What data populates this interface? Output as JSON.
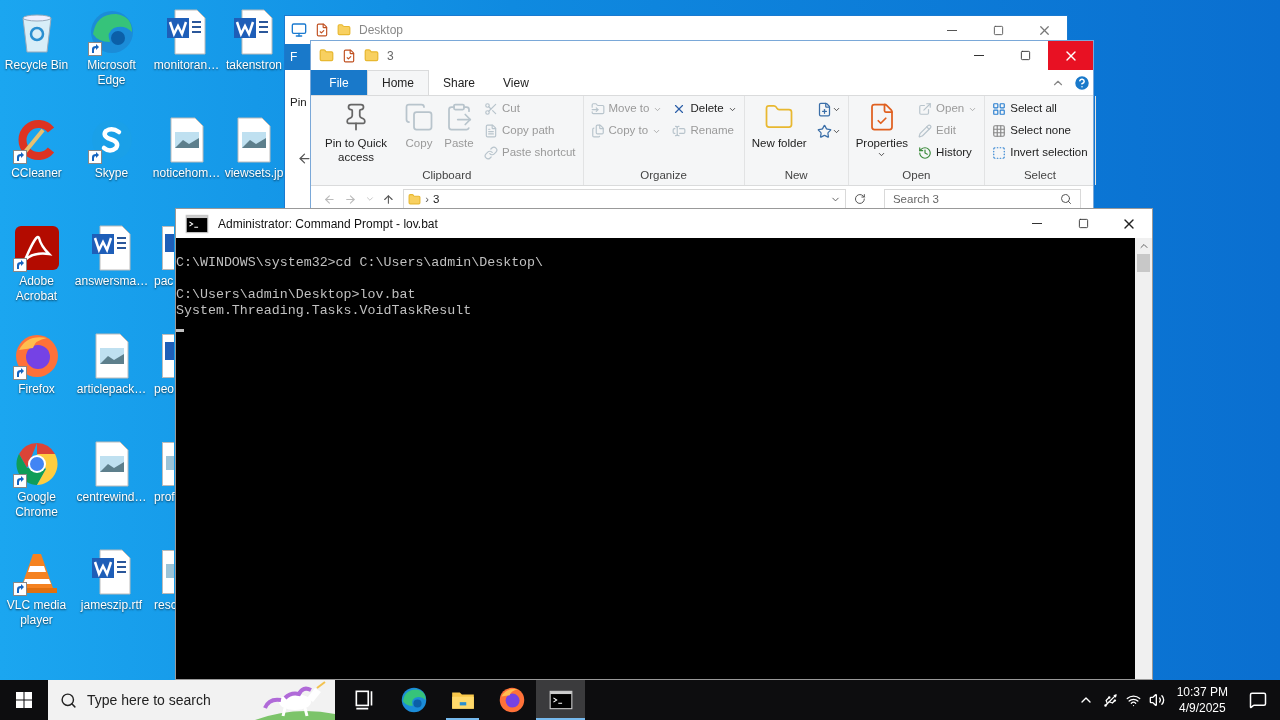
{
  "desktop": {
    "icons": [
      {
        "label": "Recycle Bin",
        "kind": "recycle",
        "shortcut": false,
        "cut": false
      },
      {
        "label": "CCleaner",
        "kind": "ccleaner",
        "shortcut": true,
        "cut": false
      },
      {
        "label": "Adobe Acrobat",
        "kind": "acrobat",
        "shortcut": true,
        "cut": false
      },
      {
        "label": "Firefox",
        "kind": "firefox",
        "shortcut": true,
        "cut": false
      },
      {
        "label": "Google Chrome",
        "kind": "chrome",
        "shortcut": true,
        "cut": false
      },
      {
        "label": "VLC media player",
        "kind": "vlc",
        "shortcut": true,
        "cut": false
      },
      {
        "label": "Microsoft Edge",
        "kind": "edge",
        "shortcut": true,
        "cut": false
      },
      {
        "label": "Skype",
        "kind": "skype",
        "shortcut": true,
        "cut": false
      },
      {
        "label": "answersma…",
        "kind": "word",
        "shortcut": false,
        "cut": false
      },
      {
        "label": "articlepack…",
        "kind": "image",
        "shortcut": false,
        "cut": false
      },
      {
        "label": "centrewind…",
        "kind": "image",
        "shortcut": false,
        "cut": false
      },
      {
        "label": "jameszip.rtf",
        "kind": "word",
        "shortcut": false,
        "cut": false
      },
      {
        "label": "monitoran…",
        "kind": "word",
        "shortcut": false,
        "cut": false
      },
      {
        "label": "noticehom…",
        "kind": "image",
        "shortcut": false,
        "cut": false
      },
      {
        "label": "pac",
        "kind": "word",
        "cut": true
      },
      {
        "label": "peo",
        "kind": "word",
        "cut": true
      },
      {
        "label": "prof",
        "kind": "image",
        "cut": true
      },
      {
        "label": "resc",
        "kind": "image",
        "cut": true
      },
      {
        "label": "takenstron",
        "kind": "word",
        "shortcut": false,
        "cut": false
      },
      {
        "label": "viewsets.jp",
        "kind": "image",
        "shortcut": false,
        "cut": false
      }
    ]
  },
  "back_window": {
    "title": "Desktop",
    "tab": "F",
    "ribbon_text": "Pin"
  },
  "explorer": {
    "title": "3",
    "tabs": [
      {
        "label": "File",
        "kind": "file",
        "selected": false
      },
      {
        "label": "Home",
        "kind": "tab",
        "selected": true
      },
      {
        "label": "Share",
        "kind": "tab",
        "selected": false
      },
      {
        "label": "View",
        "kind": "tab",
        "selected": false
      }
    ],
    "groups": [
      {
        "label": "Clipboard",
        "columns": [
          [
            {
              "label": "Pin to Quick access",
              "kind": "large",
              "disabled": false,
              "dropdown": false
            }
          ],
          [
            {
              "label": "Copy",
              "kind": "large",
              "disabled": true,
              "dropdown": false
            }
          ],
          [
            {
              "label": "Paste",
              "kind": "large",
              "disabled": true,
              "dropdown": false
            }
          ],
          [
            {
              "label": "Cut",
              "kind": "small",
              "disabled": true,
              "dropdown": false
            },
            {
              "label": "Copy path",
              "kind": "small",
              "disabled": true,
              "dropdown": false
            },
            {
              "label": "Paste shortcut",
              "kind": "small",
              "disabled": true,
              "dropdown": false
            }
          ]
        ]
      },
      {
        "label": "Organize",
        "columns": [
          [
            {
              "label": "Move to",
              "kind": "small",
              "disabled": true,
              "dropdown": true
            },
            {
              "label": "Copy to",
              "kind": "small",
              "disabled": true,
              "dropdown": true
            }
          ],
          [
            {
              "label": "Delete",
              "kind": "small",
              "disabled": false,
              "dropdown": true
            },
            {
              "label": "Rename",
              "kind": "small",
              "disabled": true,
              "dropdown": false
            }
          ]
        ]
      },
      {
        "label": "New",
        "columns": [
          [
            {
              "label": "New folder",
              "kind": "large",
              "disabled": false,
              "dropdown": false
            }
          ],
          [
            {
              "kind": "icon",
              "disabled": false,
              "dropdown": true
            },
            {
              "kind": "icon",
              "disabled": false,
              "dropdown": true
            }
          ]
        ]
      },
      {
        "label": "Open",
        "columns": [
          [
            {
              "label": "Properties",
              "kind": "large",
              "disabled": false,
              "dropdown": true
            }
          ],
          [
            {
              "label": "Open",
              "kind": "small",
              "disabled": true,
              "dropdown": true
            },
            {
              "label": "Edit",
              "kind": "small",
              "disabled": true,
              "dropdown": false
            },
            {
              "label": "History",
              "kind": "small",
              "disabled": false,
              "dropdown": false
            }
          ]
        ]
      },
      {
        "label": "Select",
        "columns": [
          [
            {
              "label": "Select all",
              "kind": "small",
              "disabled": false,
              "dropdown": false
            },
            {
              "label": "Select none",
              "kind": "small",
              "disabled": false,
              "dropdown": false
            },
            {
              "label": "Invert selection",
              "kind": "small",
              "disabled": false,
              "dropdown": false
            }
          ]
        ]
      }
    ],
    "address": "3",
    "separator": "›",
    "search": {
      "placeholder": "Search 3"
    }
  },
  "console": {
    "title": "Administrator: Command Prompt - lov.bat",
    "blocks": [
      [
        "C:\\WINDOWS\\system32>cd C:\\Users\\admin\\Desktop\\"
      ],
      [
        "C:\\Users\\admin\\Desktop>lov.bat",
        "System.Threading.Tasks.VoidTaskResult"
      ]
    ]
  },
  "taskbar": {
    "search": {
      "placeholder": "Type here to search"
    },
    "apps": [
      {
        "kind": "taskview",
        "running": false,
        "selected": false
      },
      {
        "kind": "edge",
        "running": false,
        "selected": false
      },
      {
        "kind": "explorer",
        "running": true,
        "selected": false
      },
      {
        "kind": "firefox",
        "running": false,
        "selected": false
      },
      {
        "kind": "cmd",
        "running": true,
        "selected": true
      }
    ],
    "clock": {
      "time": "10:37 PM",
      "date": "4/9/2025"
    }
  }
}
